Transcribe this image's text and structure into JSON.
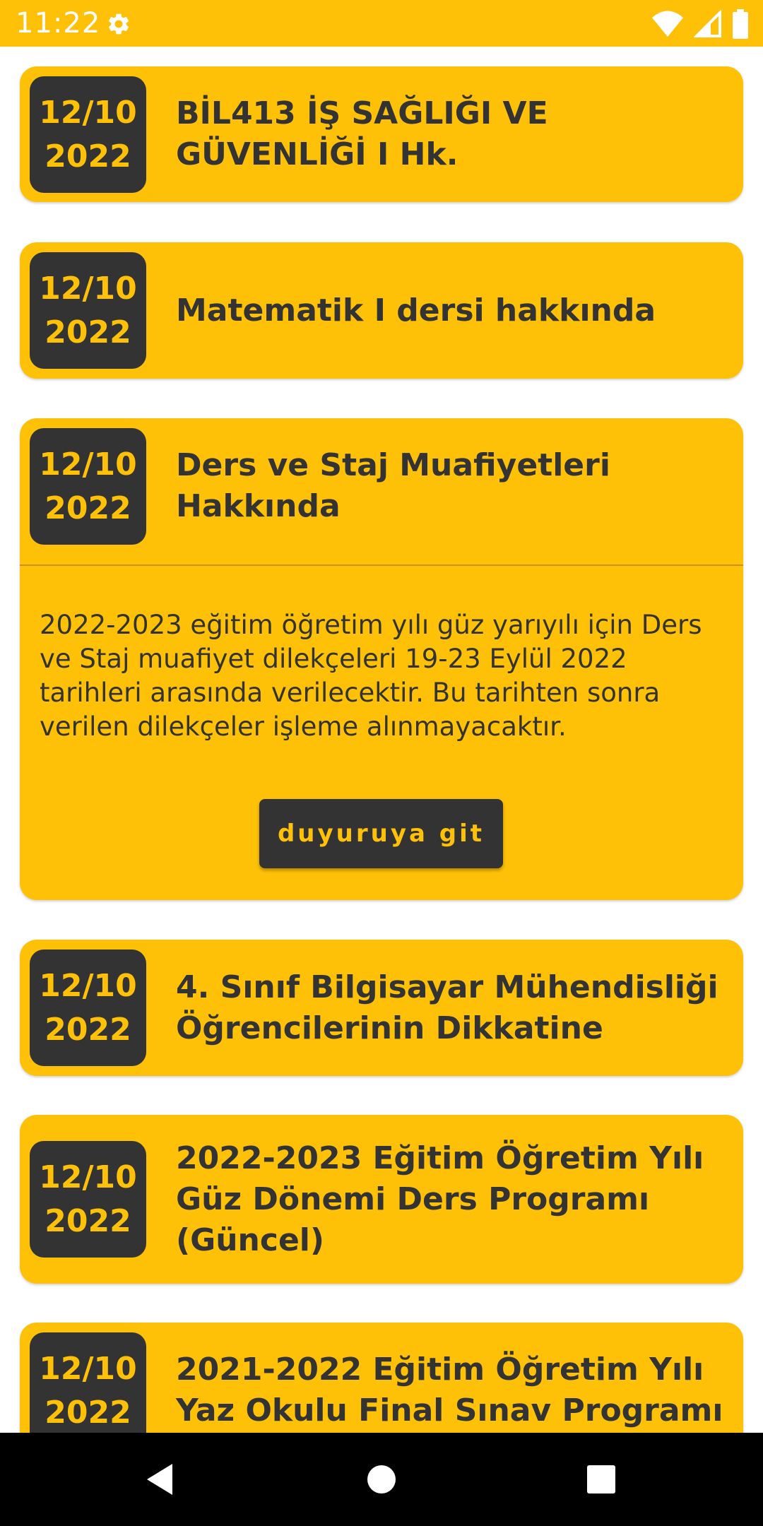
{
  "status_bar": {
    "time": "11:22",
    "icons": [
      "settings-gear-icon",
      "wifi-icon",
      "cellular-signal-icon",
      "battery-icon"
    ],
    "color": "#FFC107"
  },
  "theme": {
    "accent": "#FFC107",
    "dark": "#333333"
  },
  "announcements": [
    {
      "date_line1": "12/10",
      "date_line2": "2022",
      "title": "BİL413 İŞ SAĞLIĞI VE GÜVENLİĞİ I Hk.",
      "expanded": false
    },
    {
      "date_line1": "12/10",
      "date_line2": "2022",
      "title": "Matematik I dersi hakkında",
      "expanded": false
    },
    {
      "date_line1": "12/10",
      "date_line2": "2022",
      "title": "Ders ve Staj Muafiyetleri Hakkında",
      "expanded": true,
      "body": "2022-2023 eğitim öğretim yılı güz yarıyılı için Ders ve Staj muafiyet dilekçeleri 19-23 Eylül 2022 tarihleri arasında verilecektir. Bu tarihten sonra verilen dilekçeler işleme alınmayacaktır.",
      "button_label": "duyuruya git"
    },
    {
      "date_line1": "12/10",
      "date_line2": "2022",
      "title": "4. Sınıf Bilgisayar Mühendisliği Öğrencilerinin Dikkatine",
      "expanded": false
    },
    {
      "date_line1": "12/10",
      "date_line2": "2022",
      "title": "2022-2023 Eğitim Öğretim Yılı Güz Dönemi Ders Programı (Güncel)",
      "expanded": false
    },
    {
      "date_line1": "12/10",
      "date_line2": "2022",
      "title": "2021-2022 Eğitim Öğretim Yılı Yaz Okulu Final Sınav Programı",
      "expanded": false
    }
  ],
  "nav_bar": {
    "buttons": [
      "back-icon",
      "home-icon",
      "recents-icon"
    ]
  }
}
